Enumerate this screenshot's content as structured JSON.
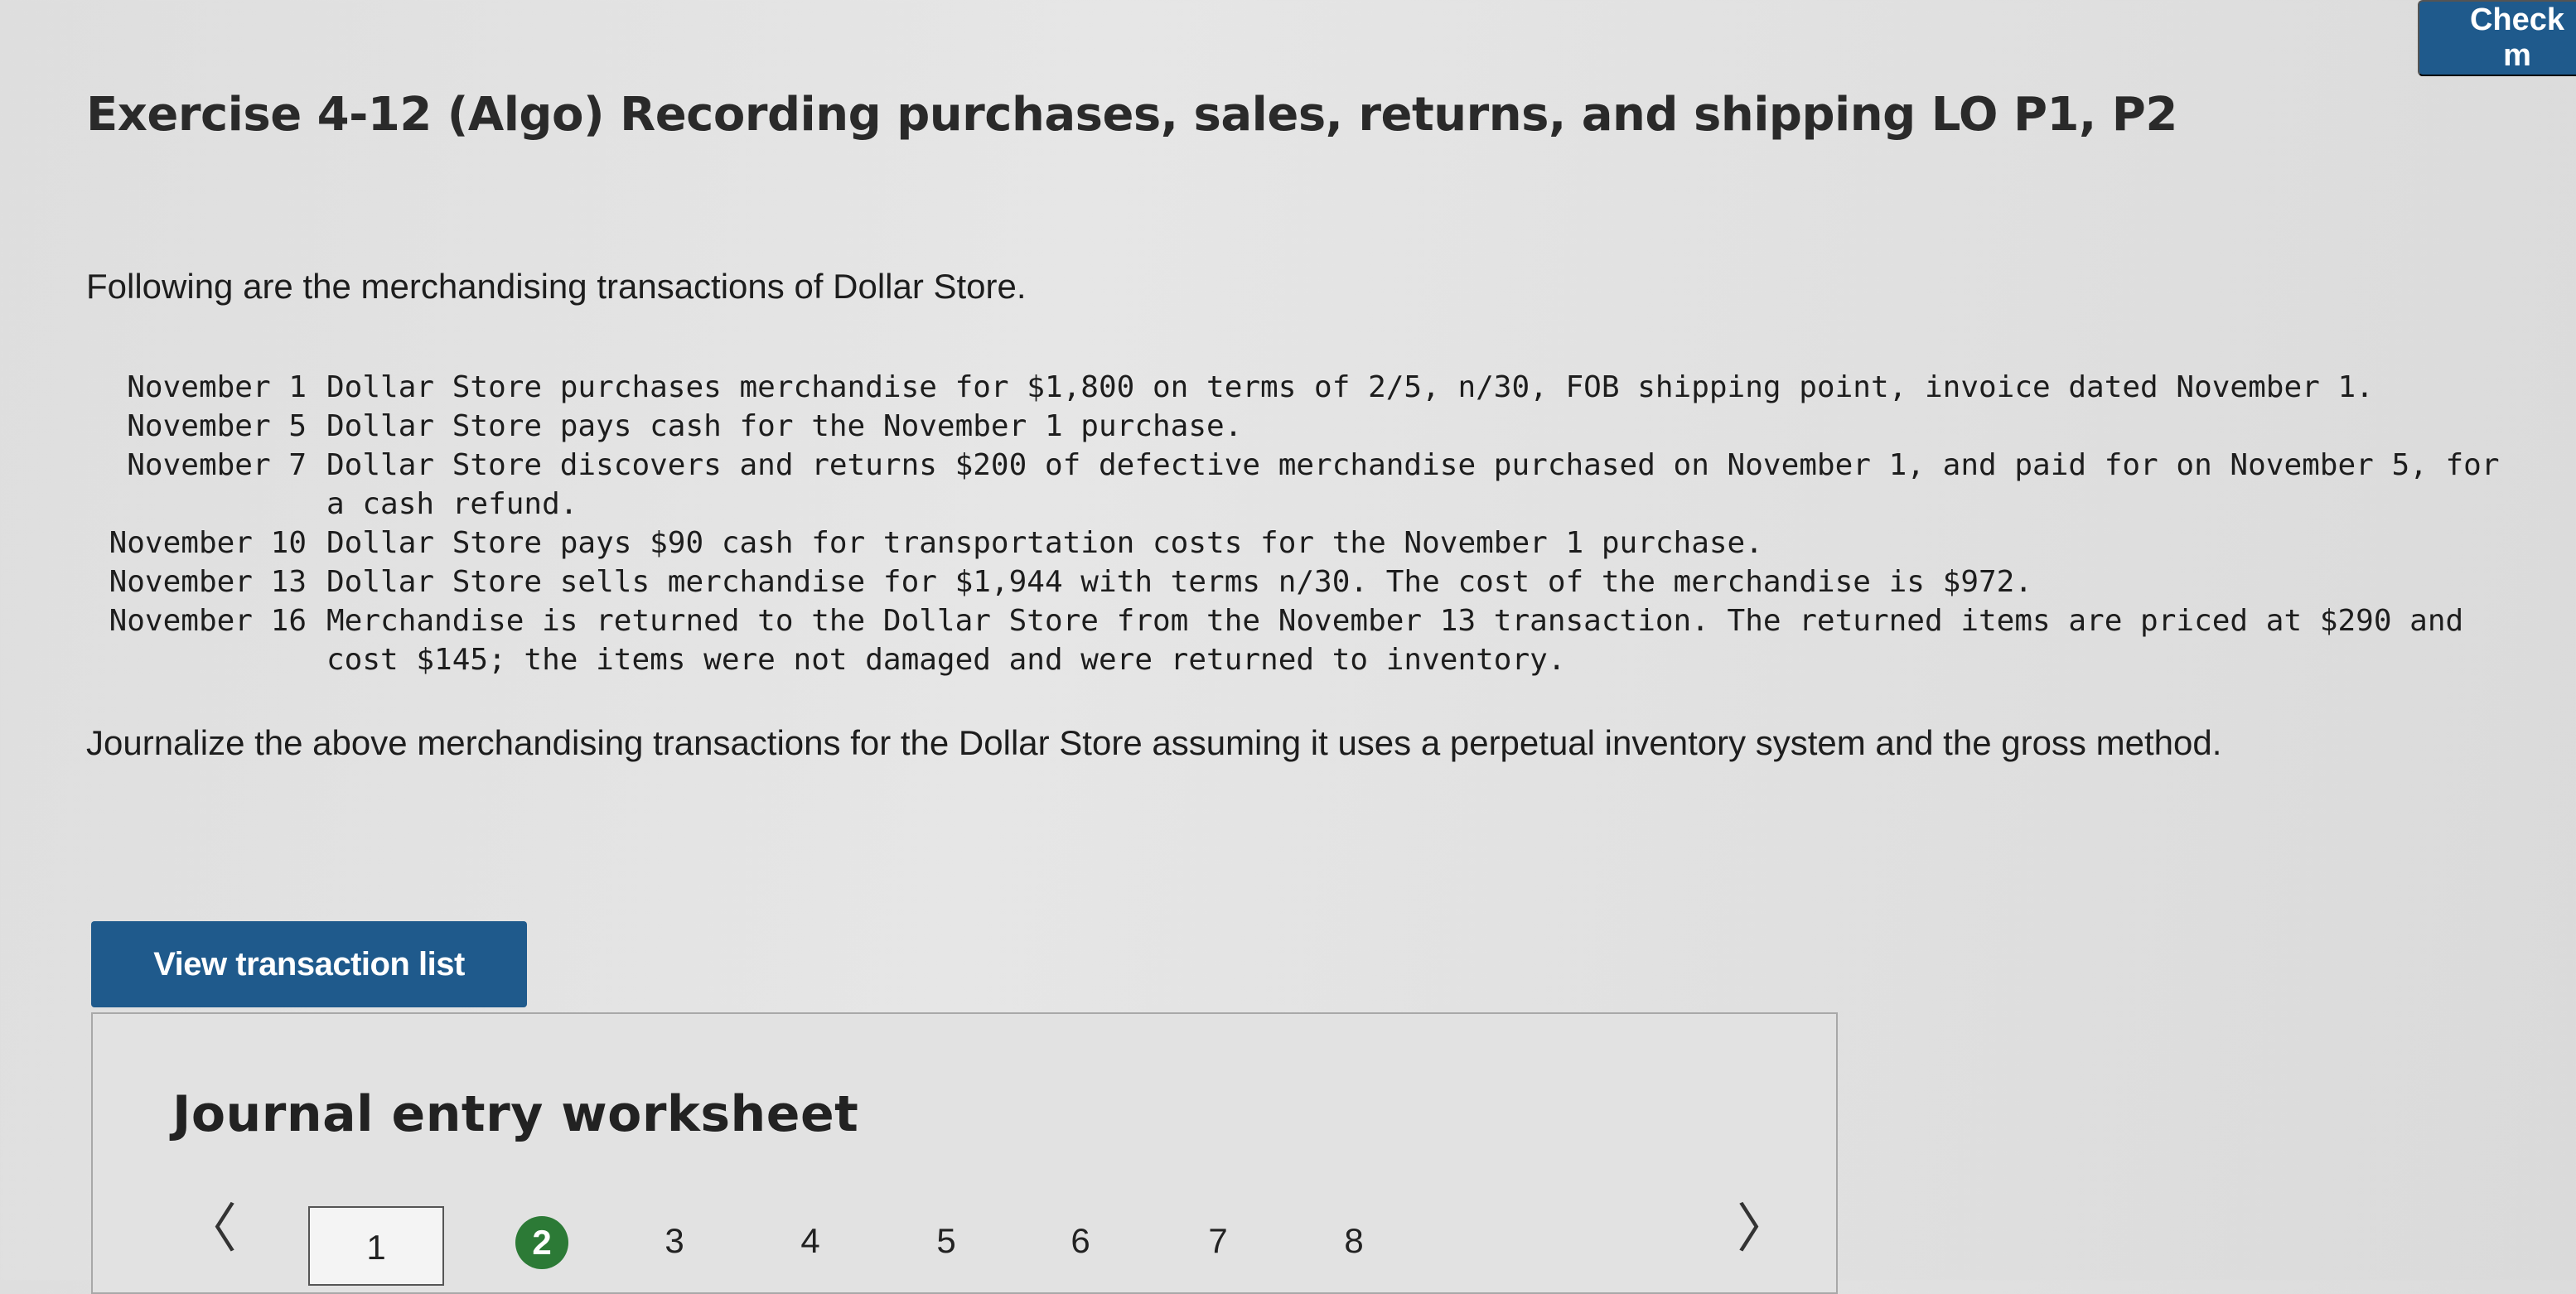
{
  "header": {
    "check_label": "Check m"
  },
  "exercise": {
    "title": "Exercise 4-12 (Algo) Recording purchases, sales, returns, and shipping LO P1, P2",
    "intro": "Following are the merchandising transactions of Dollar Store.",
    "transactions": [
      {
        "date": "November 1",
        "description": "Dollar Store purchases merchandise for $1,800 on terms of 2/5, n/30, FOB shipping point, invoice dated November 1."
      },
      {
        "date": "November 5",
        "description": "Dollar Store pays cash for the November 1 purchase."
      },
      {
        "date": "November 7",
        "description": "Dollar Store discovers and returns $200 of defective merchandise purchased on November 1, and paid for on November 5, for a cash refund."
      },
      {
        "date": "November 10",
        "description": "Dollar Store pays $90 cash for transportation costs for the November 1 purchase."
      },
      {
        "date": "November 13",
        "description": "Dollar Store sells merchandise for $1,944 with terms n/30. The cost of the merchandise is $972."
      },
      {
        "date": "November 16",
        "description": "Merchandise is returned to the Dollar Store from the November 13 transaction. The returned items are priced at $290 and cost $145; the items were not damaged and were returned to inventory."
      }
    ],
    "instruction": "Journalize the above merchandising transactions for the Dollar Store assuming it uses a perpetual inventory system and the gross method."
  },
  "buttons": {
    "view_transactions": "View transaction list"
  },
  "worksheet": {
    "title": "Journal entry worksheet",
    "prev_icon": "chevron-left-icon",
    "next_icon": "chevron-right-icon",
    "prev_glyph": "〈",
    "next_glyph": "〉",
    "pages": [
      "1",
      "2",
      "3",
      "4",
      "5",
      "6",
      "7",
      "8"
    ],
    "current_page": "1",
    "completed_page": "2"
  },
  "colors": {
    "primary_button": "#1f5a8c",
    "completed_badge": "#2c7a36",
    "background": "#e0e0e0"
  }
}
